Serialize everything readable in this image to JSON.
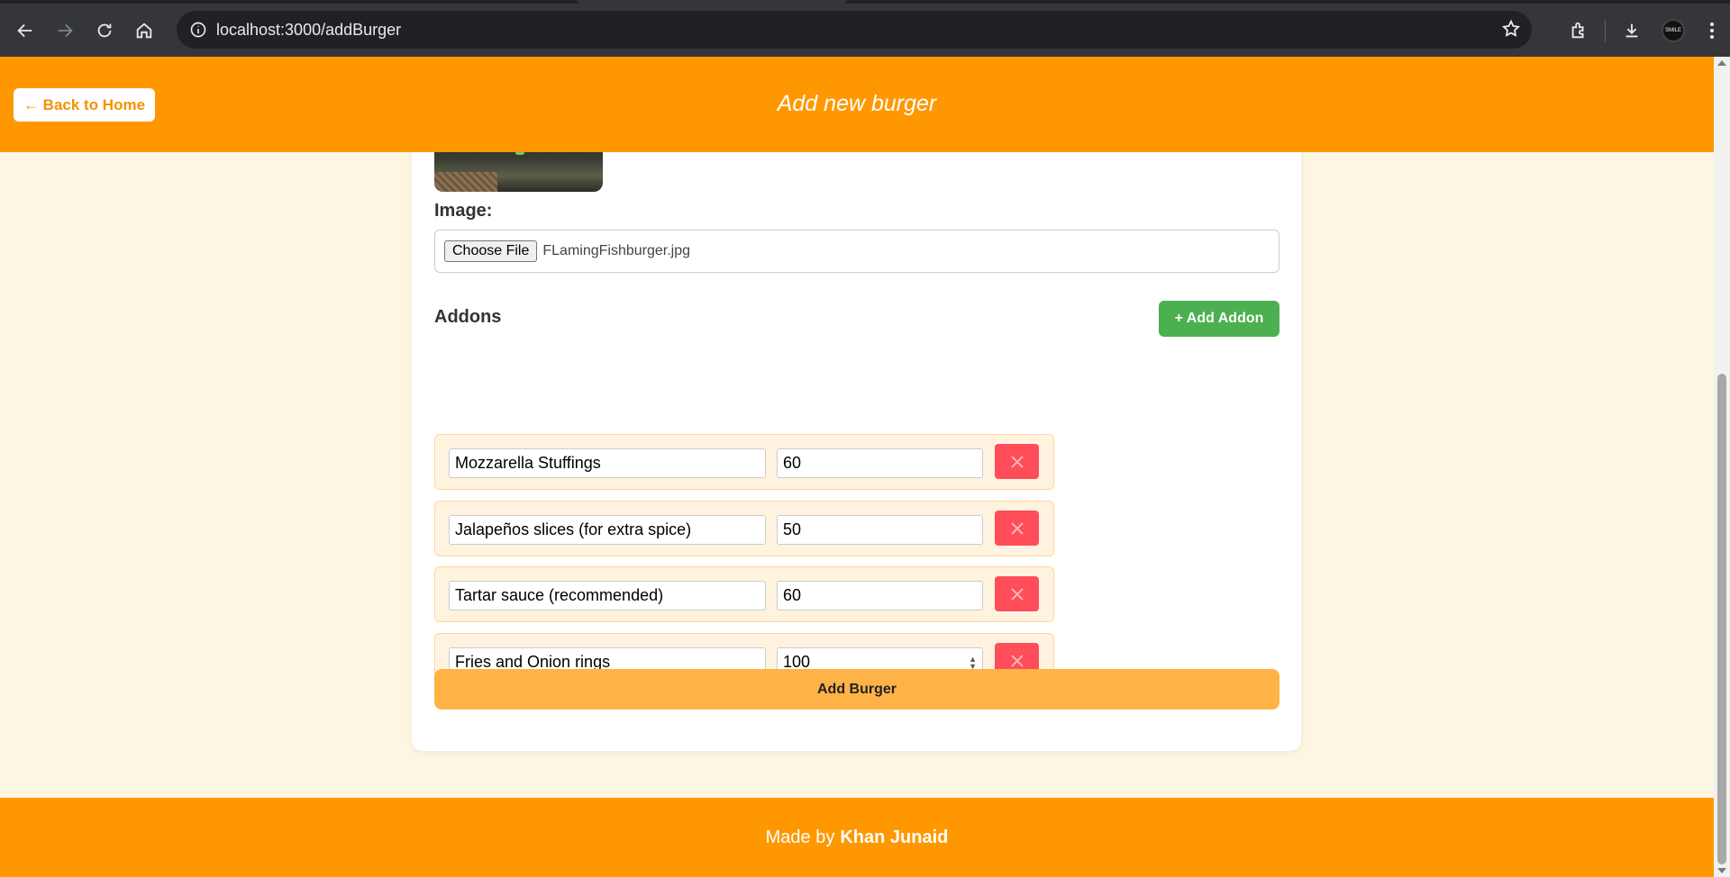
{
  "browser": {
    "url": "localhost:3000/addBurger",
    "profile_text": "SMILE"
  },
  "header": {
    "back_label": "← Back to Home",
    "title": "Add new burger"
  },
  "form": {
    "image_label": "Image:",
    "choose_file_label": "Choose File",
    "file_name": "FLamingFishburger.jpg",
    "addons_title": "Addons",
    "add_addon_label": "+ Add Addon",
    "addons": [
      {
        "name": "Mozzarella Stuffings",
        "price": "60"
      },
      {
        "name": "Jalapeños slices (for extra spice)",
        "price": "50"
      },
      {
        "name": "Tartar sauce (recommended)",
        "price": "60"
      },
      {
        "name": "Fries and Onion rings",
        "price": "100"
      }
    ],
    "submit_label": "Add Burger"
  },
  "footer": {
    "prefix": "Made by",
    "author": "Khan Junaid"
  },
  "colors": {
    "primary": "#ff9800",
    "background": "#fdf6e3",
    "success": "#4caf50",
    "danger": "#ff4d5a",
    "submit": "#ffb347"
  }
}
